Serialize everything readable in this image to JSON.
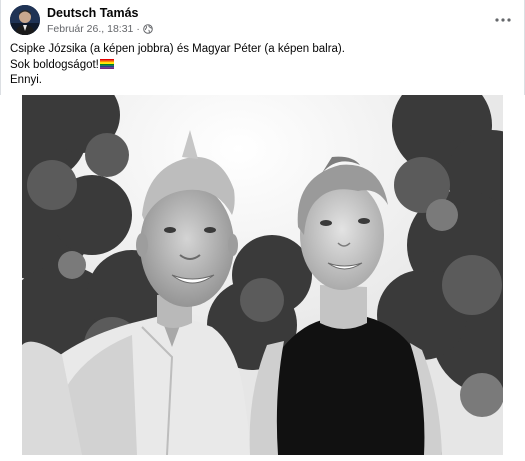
{
  "post": {
    "author": {
      "name": "Deutsch Tamás",
      "avatar_icon": "profile-photo"
    },
    "timestamp": "Február 26., 18:31",
    "separator": "·",
    "audience_icon": "globe-icon",
    "more_icon": "more-options-icon",
    "text_lines": [
      "Csipke Józsika (a képen jobbra) és Magyar Péter (a képen balra).",
      "Sok boldogságot!",
      "Ennyi."
    ],
    "emoji": "rainbow-flag",
    "photo": {
      "style": "black-and-white selfie, two people in front of trees"
    }
  },
  "colors": {
    "text_primary": "#050505",
    "text_secondary": "#65676b",
    "border": "#dcdfe3"
  }
}
